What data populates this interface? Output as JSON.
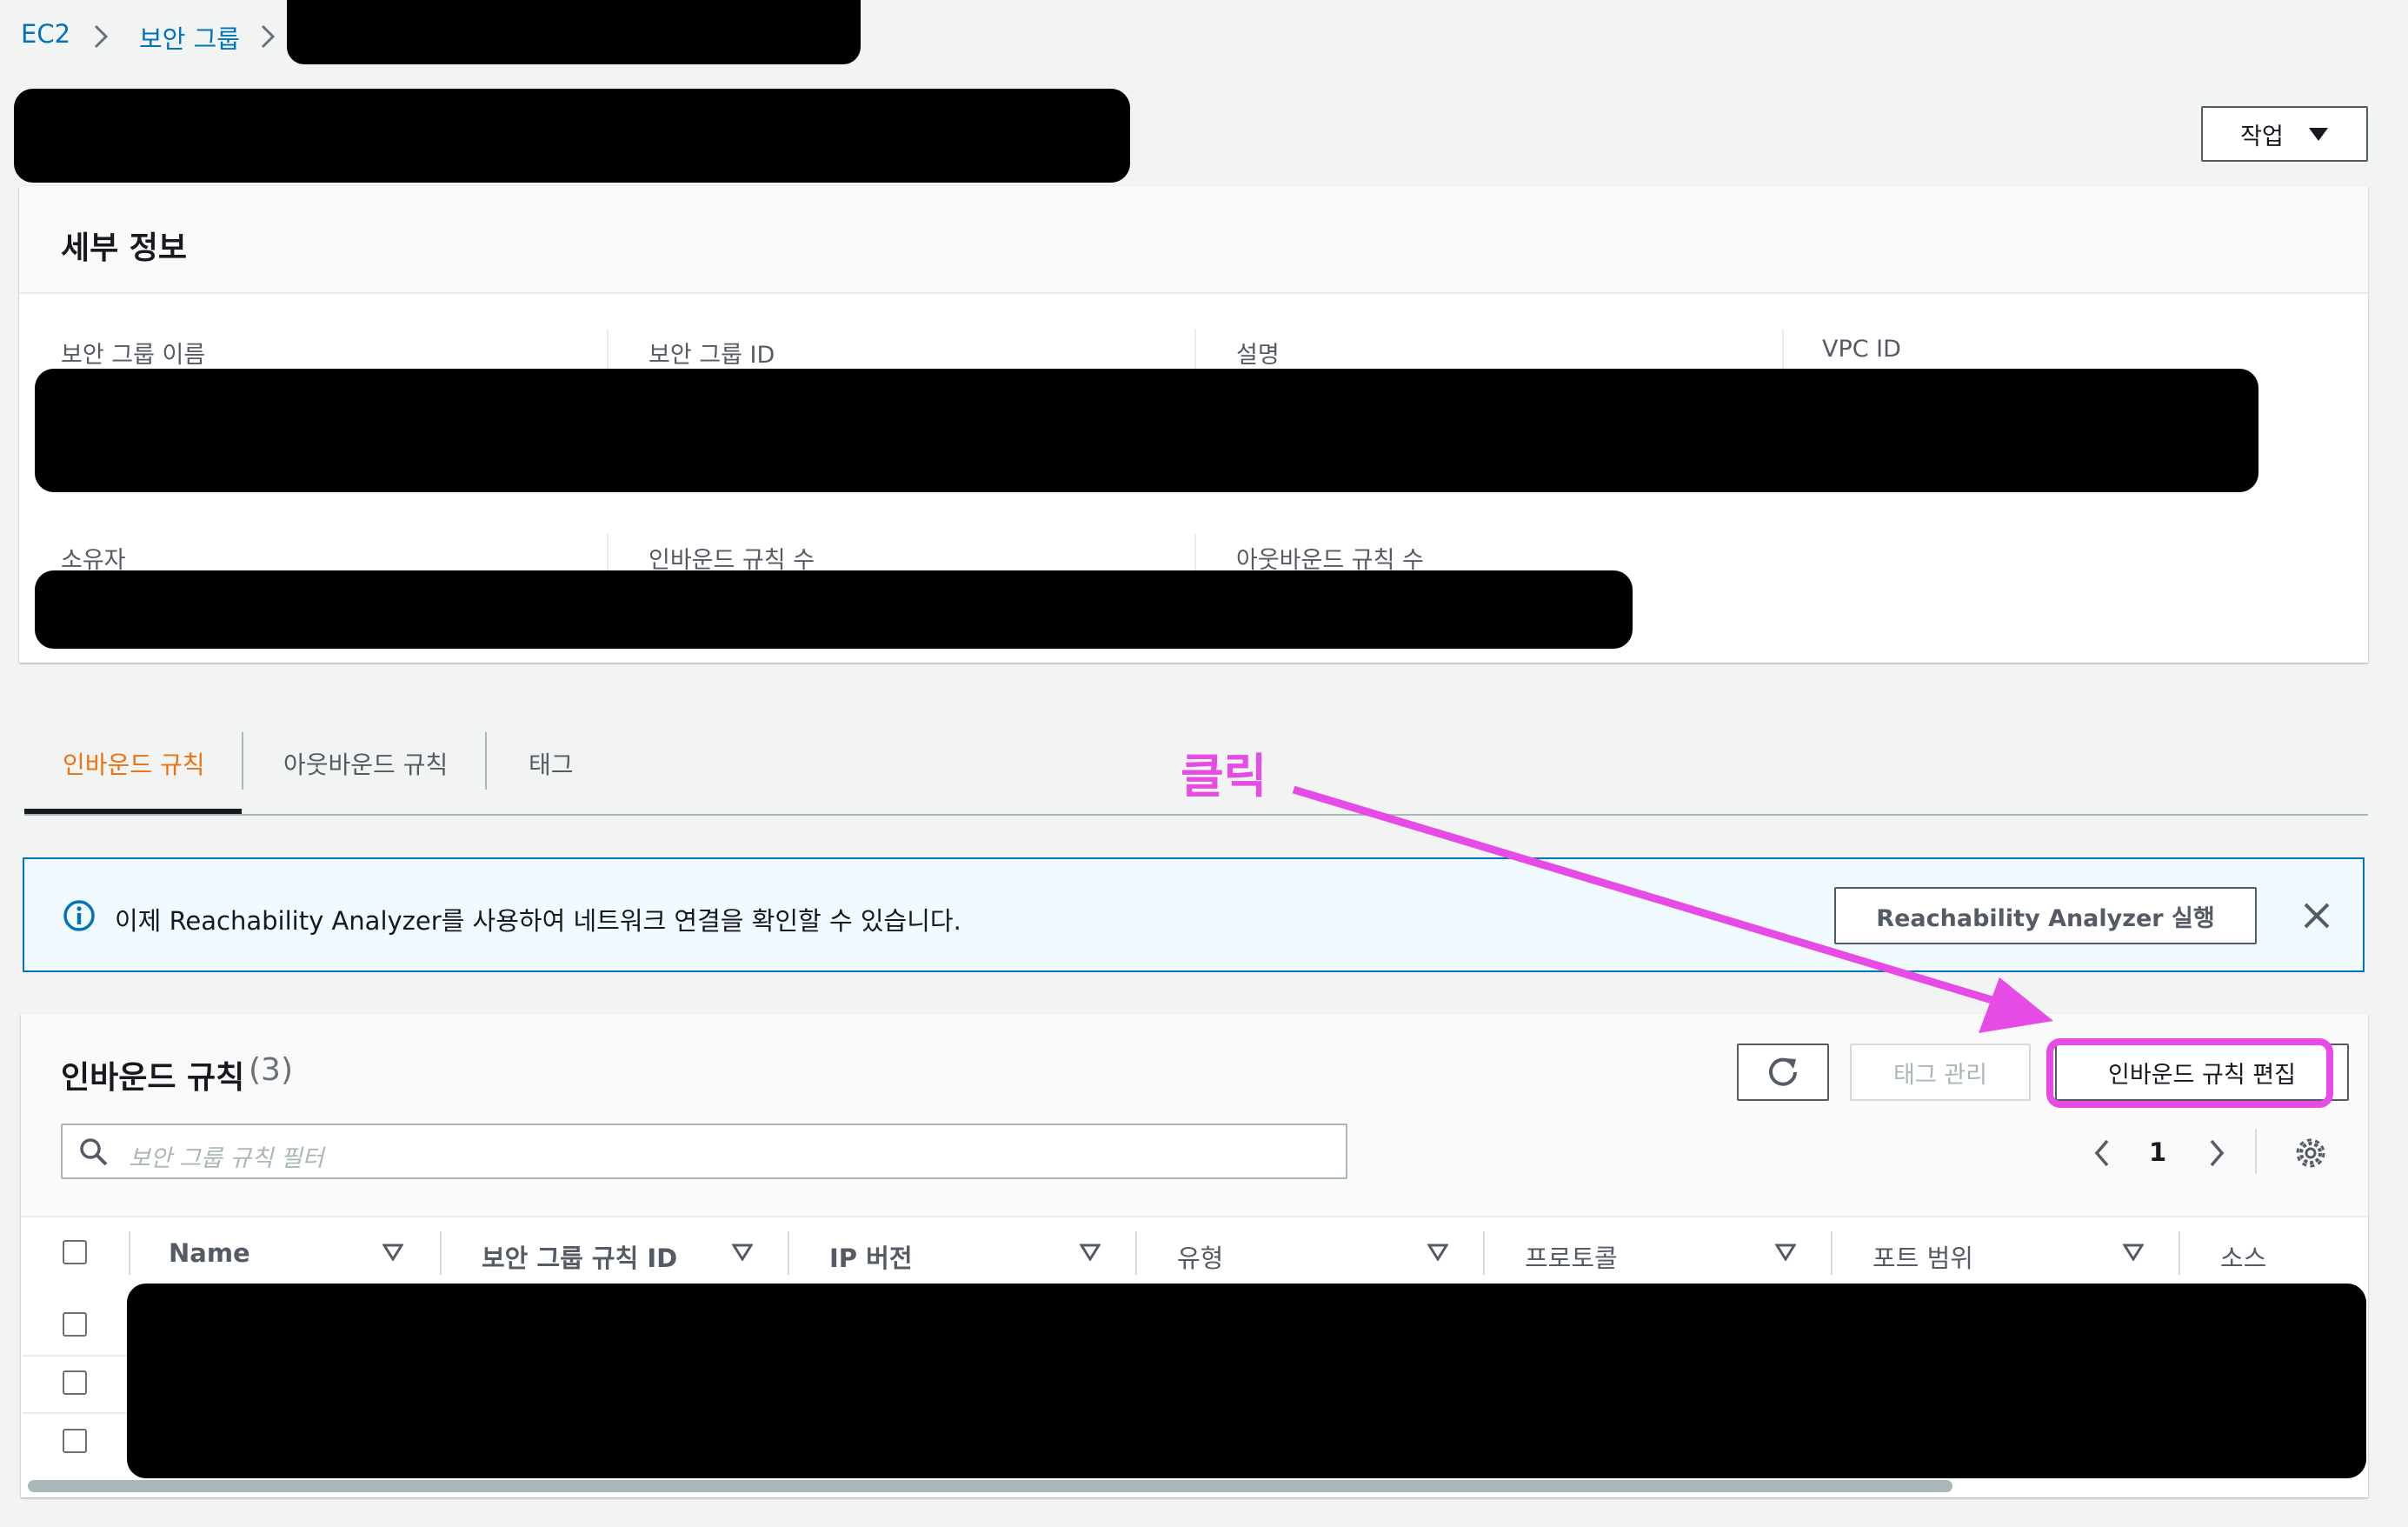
{
  "breadcrumb": {
    "root": "EC2",
    "section": "보안 그룹"
  },
  "header": {
    "actions_label": "작업"
  },
  "details": {
    "title": "세부 정보",
    "labels": [
      "보안 그룹 이름",
      "보안 그룹 ID",
      "설명",
      "VPC ID",
      "소유자",
      "인바운드 규칙 수",
      "아웃바운드 규칙 수"
    ]
  },
  "tabs": [
    "인바운드 규칙",
    "아웃바운드 규칙",
    "태그"
  ],
  "banner": {
    "message": "이제 Reachability Analyzer를 사용하여 네트워크 연결을 확인할 수 있습니다.",
    "button_label": "Reachability Analyzer 실행"
  },
  "rules": {
    "title": "인바운드 규칙",
    "count": "(3)",
    "manage_tags_label": "태그 관리",
    "edit_label": "인바운드 규칙 편집",
    "filter_placeholder": "보안 그룹 규칙 필터",
    "page": "1",
    "columns": [
      "Name",
      "보안 그룹 규칙 ID",
      "IP 버전",
      "유형",
      "프로토콜",
      "포트 범위",
      "소스"
    ]
  },
  "annotation": {
    "text": "클릭"
  },
  "colors": {
    "link": "#0073bb",
    "active_tab": "#ec7211",
    "annotation": "#e64be6"
  }
}
